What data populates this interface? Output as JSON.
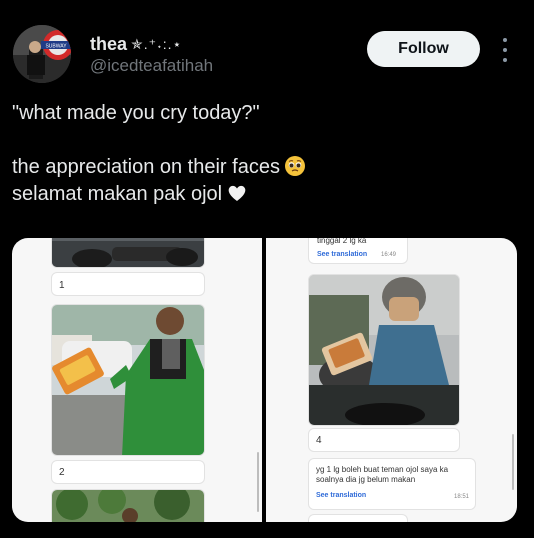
{
  "author": {
    "display_name": "thea",
    "sparkles": "✯.⁺˖:.⋆",
    "handle": "@icedteafatihah",
    "avatar_sign": "SUBWAY"
  },
  "actions": {
    "follow_label": "Follow",
    "more": "more-icon"
  },
  "tweet": {
    "line1": "\"what made you cry today?\"",
    "line2": "the appreciation on their faces",
    "line3": "selamat makan pak ojol",
    "emoji1": "pleading-face-icon",
    "emoji2": "white-heart-icon"
  },
  "media": {
    "left": {
      "item1_number": "1",
      "item2_number": "2"
    },
    "right": {
      "top_text": "tinggal 2 lg ka",
      "top_see_translation": "See translation",
      "top_time": "16:49",
      "item4_number": "4",
      "msg_line1": "yg 1 lg boleh buat teman ojol saya ka",
      "msg_line2": "soalnya dia jg belum makan",
      "msg_see_translation": "See translation",
      "msg_time": "18:51"
    }
  },
  "colors": {
    "background": "#000000",
    "text": "#e7e9ea",
    "muted": "#71767b",
    "follow_bg": "#eff3f4",
    "link": "#2f6bd8"
  }
}
